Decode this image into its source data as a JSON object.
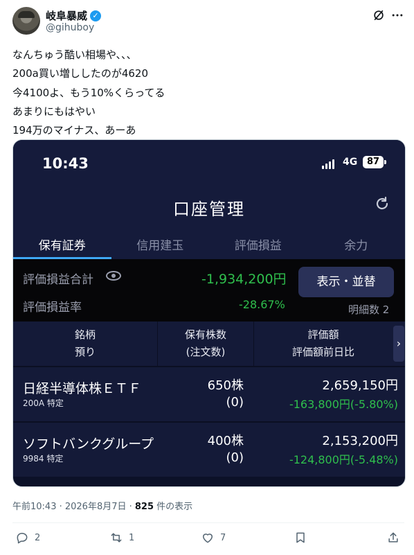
{
  "author": {
    "name": "岐阜暴威",
    "handle": "@gihuboy"
  },
  "tweet": {
    "lines": [
      "なんちゅう酷い相場や、、、",
      "200a買い増ししたのが4620",
      "今4100よ、もう10%くらってる",
      "あまりにもはやい",
      "194万のマイナス、あーあ"
    ]
  },
  "screenshot": {
    "status_time": "10:43",
    "network": "4G",
    "battery": "87",
    "app_title": "口座管理",
    "tabs": [
      "保有証券",
      "信用建玉",
      "評価損益",
      "余力"
    ],
    "summary": {
      "total_label": "評価損益合計",
      "total_value": "-1,934,200円",
      "rate_label": "評価損益率",
      "rate_value": "-28.67%",
      "switch_button": "表示・並替",
      "detail_count": "明細数 2"
    },
    "table": {
      "headers": [
        {
          "l1": "銘柄",
          "l2": "預り"
        },
        {
          "l1": "保有株数",
          "l2": "(注文数)"
        },
        {
          "l1": "評価額",
          "l2": "評価額前日比"
        }
      ],
      "rows": [
        {
          "name": "日経半導体株ＥＴＦ",
          "code": "200A 特定",
          "shares": "650株",
          "orders": "(0)",
          "value": "2,659,150円",
          "change": "-163,800円(-5.80%)"
        },
        {
          "name": "ソフトバンクグループ",
          "code": "9984 特定",
          "shares": "400株",
          "orders": "(0)",
          "value": "2,153,200円",
          "change": "-124,800円(-5.48%)"
        }
      ]
    },
    "colors": {
      "accent_tab": "#3fa8f5",
      "loss_green": "#2fbf4d",
      "panel": "#141a38"
    }
  },
  "meta": {
    "timestamp": "午前10:43 · 2026年8月7日 · ",
    "views": "825",
    "views_suffix": " 件の表示"
  },
  "actions": {
    "replies": "2",
    "reposts": "1",
    "likes": "7"
  }
}
